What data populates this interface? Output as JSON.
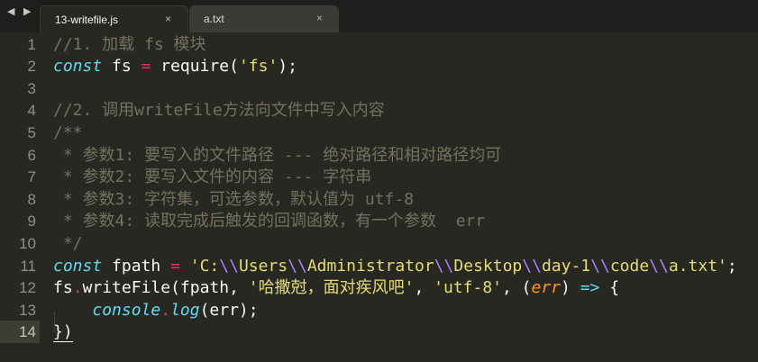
{
  "tabs": [
    {
      "label": "13-writefile.js",
      "close": "×",
      "active": true
    },
    {
      "label": "a.txt",
      "close": "×",
      "active": false
    }
  ],
  "nav": {
    "arrows": "◀ ▶"
  },
  "colors": {
    "background": "#272822",
    "comment": "#75715e",
    "keyword": "#66d9ef",
    "operator": "#f92672",
    "string": "#e6db74",
    "escape": "#ae81ff",
    "parameter": "#fd971f",
    "text": "#f8f8f2"
  },
  "active_line": 14,
  "lines": [
    {
      "n": "1",
      "tokens": [
        {
          "t": "comment",
          "s": "//1. 加载 fs 模块"
        }
      ]
    },
    {
      "n": "2",
      "tokens": [
        {
          "t": "storage",
          "s": "const"
        },
        {
          "t": "plain",
          "s": " fs "
        },
        {
          "t": "op",
          "s": "="
        },
        {
          "t": "plain",
          "s": " require("
        },
        {
          "t": "string",
          "s": "'fs'"
        },
        {
          "t": "plain",
          "s": ");"
        }
      ]
    },
    {
      "n": "3",
      "tokens": []
    },
    {
      "n": "4",
      "tokens": [
        {
          "t": "comment",
          "s": "//2. 调用writeFile方法向文件中写入内容"
        }
      ]
    },
    {
      "n": "5",
      "tokens": [
        {
          "t": "comment",
          "s": "/**"
        }
      ]
    },
    {
      "n": "6",
      "tokens": [
        {
          "t": "comment",
          "s": " * 参数1: 要写入的文件路径 --- 绝对路径和相对路径均可"
        }
      ]
    },
    {
      "n": "7",
      "tokens": [
        {
          "t": "comment",
          "s": " * 参数2: 要写入文件的内容 --- 字符串"
        }
      ]
    },
    {
      "n": "8",
      "tokens": [
        {
          "t": "comment",
          "s": " * 参数3: 字符集，可选参数，默认值为 utf-8"
        }
      ]
    },
    {
      "n": "9",
      "tokens": [
        {
          "t": "comment",
          "s": " * 参数4: 读取完成后触发的回调函数，有一个参数  err"
        }
      ]
    },
    {
      "n": "10",
      "tokens": [
        {
          "t": "comment",
          "s": " */"
        }
      ]
    },
    {
      "n": "11",
      "tokens": [
        {
          "t": "storage",
          "s": "const"
        },
        {
          "t": "plain",
          "s": " fpath "
        },
        {
          "t": "op",
          "s": "="
        },
        {
          "t": "plain",
          "s": " "
        },
        {
          "t": "string",
          "s": "'C:"
        },
        {
          "t": "escape",
          "s": "\\\\"
        },
        {
          "t": "string",
          "s": "Users"
        },
        {
          "t": "escape",
          "s": "\\\\"
        },
        {
          "t": "string",
          "s": "Administrator"
        },
        {
          "t": "escape",
          "s": "\\\\"
        },
        {
          "t": "string",
          "s": "Desktop"
        },
        {
          "t": "escape",
          "s": "\\\\"
        },
        {
          "t": "string",
          "s": "day-1"
        },
        {
          "t": "escape",
          "s": "\\\\"
        },
        {
          "t": "string",
          "s": "code"
        },
        {
          "t": "escape",
          "s": "\\\\"
        },
        {
          "t": "string",
          "s": "a.txt'"
        },
        {
          "t": "plain",
          "s": ";"
        }
      ]
    },
    {
      "n": "12",
      "tokens": [
        {
          "t": "plain",
          "s": "fs"
        },
        {
          "t": "op",
          "s": "."
        },
        {
          "t": "plain",
          "s": "writeFile(fpath, "
        },
        {
          "t": "string",
          "s": "'哈撒尅，面对疾风吧'"
        },
        {
          "t": "plain",
          "s": ", "
        },
        {
          "t": "string",
          "s": "'utf-8'"
        },
        {
          "t": "plain",
          "s": ", ("
        },
        {
          "t": "param",
          "s": "err"
        },
        {
          "t": "plain",
          "s": ") "
        },
        {
          "t": "storage",
          "s": "=>"
        },
        {
          "t": "plain",
          "s": " {"
        }
      ]
    },
    {
      "n": "13",
      "tokens": [
        {
          "t": "plain",
          "s": "    "
        },
        {
          "t": "fn",
          "s": "console"
        },
        {
          "t": "op",
          "s": "."
        },
        {
          "t": "fn",
          "s": "log"
        },
        {
          "t": "plain",
          "s": "(err);"
        }
      ]
    },
    {
      "n": "14",
      "tokens": [
        {
          "t": "plain",
          "s": "})"
        }
      ]
    }
  ]
}
